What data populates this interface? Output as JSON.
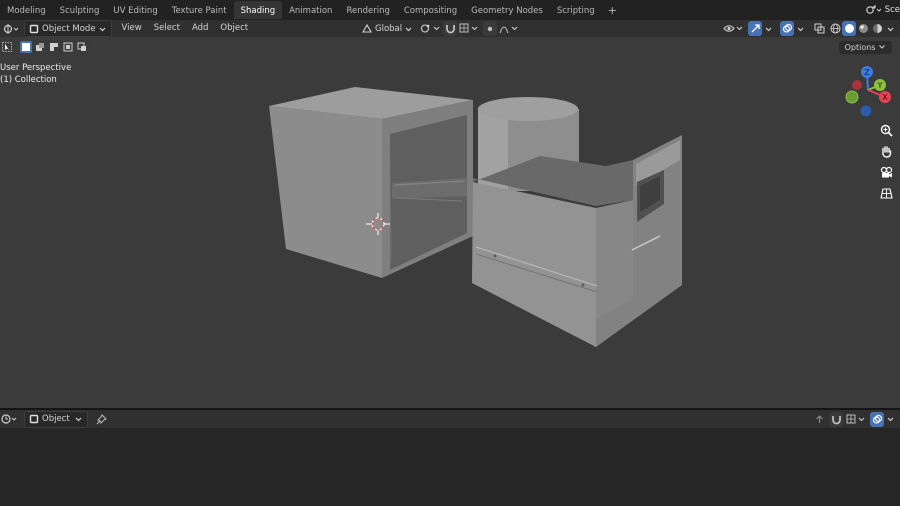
{
  "workspace_tabs": [
    {
      "label": "Modeling",
      "active": false
    },
    {
      "label": "Sculpting",
      "active": false
    },
    {
      "label": "UV Editing",
      "active": false
    },
    {
      "label": "Texture Paint",
      "active": false
    },
    {
      "label": "Shading",
      "active": true
    },
    {
      "label": "Animation",
      "active": false
    },
    {
      "label": "Rendering",
      "active": false
    },
    {
      "label": "Compositing",
      "active": false
    },
    {
      "label": "Geometry Nodes",
      "active": false
    },
    {
      "label": "Scripting",
      "active": false
    }
  ],
  "add_workspace_label": "+",
  "scene_label": "Sce",
  "viewport_header": {
    "mode_label": "Object Mode",
    "menus": [
      "View",
      "Select",
      "Add",
      "Object"
    ],
    "transform_orientation": "Global"
  },
  "viewport": {
    "perspective_label": "User Perspective",
    "collection_label": "(1) Collection",
    "options_label": "Options",
    "gizmo_axes": [
      "Z",
      "Y",
      "X"
    ]
  },
  "bottom_header": {
    "object_label": "Object"
  },
  "colors": {
    "axis_x": "#e64454",
    "axis_y": "#8bc23c",
    "axis_z": "#3a7ce3",
    "active_blue": "#4772b3",
    "viewport_bg": "#3b3b3b"
  }
}
